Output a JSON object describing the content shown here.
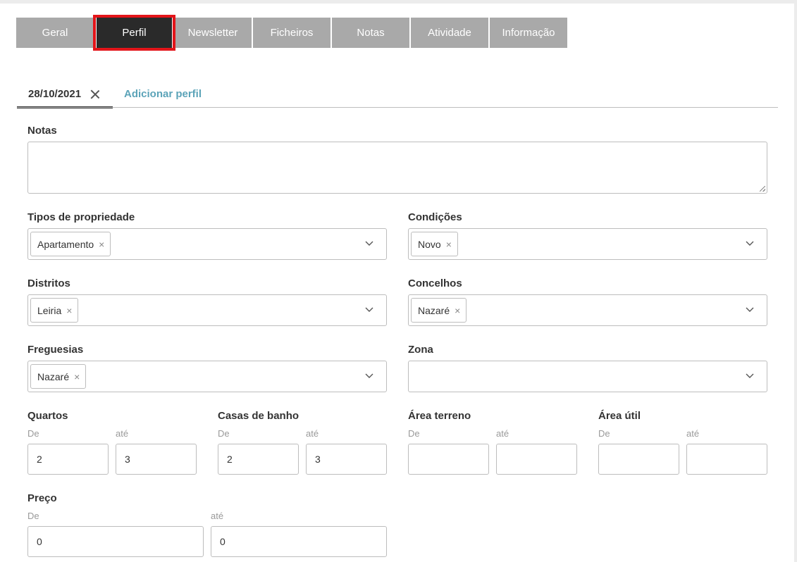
{
  "tabs": [
    {
      "label": "Geral",
      "active": false
    },
    {
      "label": "Perfil",
      "active": true
    },
    {
      "label": "Newsletter",
      "active": false
    },
    {
      "label": "Ficheiros",
      "active": false
    },
    {
      "label": "Notas",
      "active": false
    },
    {
      "label": "Atividade",
      "active": false
    },
    {
      "label": "Informação",
      "active": false
    }
  ],
  "profile_tabs": {
    "current_date": "28/10/2021",
    "add_label": "Adicionar perfil"
  },
  "form": {
    "notas": {
      "label": "Notas",
      "value": ""
    },
    "tipos_propriedade": {
      "label": "Tipos de propriedade",
      "selected": [
        "Apartamento"
      ]
    },
    "condicoes": {
      "label": "Condições",
      "selected": [
        "Novo"
      ]
    },
    "distritos": {
      "label": "Distritos",
      "selected": [
        "Leiria"
      ]
    },
    "concelhos": {
      "label": "Concelhos",
      "selected": [
        "Nazaré"
      ]
    },
    "freguesias": {
      "label": "Freguesias",
      "selected": [
        "Nazaré"
      ]
    },
    "zona": {
      "label": "Zona",
      "selected": []
    },
    "quartos": {
      "label": "Quartos",
      "from_label": "De",
      "to_label": "até",
      "from": "2",
      "to": "3"
    },
    "casas_banho": {
      "label": "Casas de banho",
      "from_label": "De",
      "to_label": "até",
      "from": "2",
      "to": "3"
    },
    "area_terreno": {
      "label": "Área terreno",
      "from_label": "De",
      "to_label": "até",
      "from": "",
      "to": ""
    },
    "area_util": {
      "label": "Área útil",
      "from_label": "De",
      "to_label": "até",
      "from": "",
      "to": ""
    },
    "preco": {
      "label": "Preço",
      "from_label": "De",
      "to_label": "até",
      "from": "0",
      "to": "0"
    }
  },
  "chip_remove_glyph": "×",
  "colors": {
    "tab_inactive": "#a9a9a9",
    "tab_active": "#2a2a2a",
    "highlight": "#e3151a",
    "link": "#5ba3b8"
  },
  "icons": {
    "chip_remove": "close-icon",
    "select_toggle": "chevron-down-icon",
    "profile_remove": "close-icon"
  }
}
